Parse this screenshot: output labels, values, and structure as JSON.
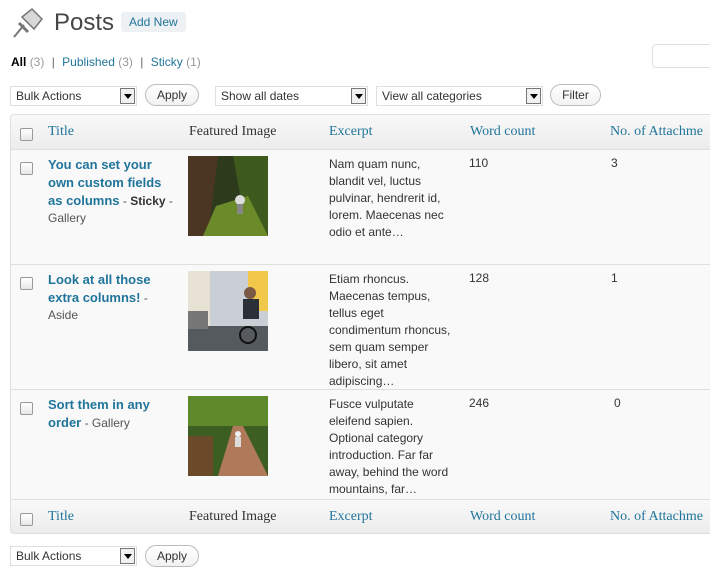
{
  "header": {
    "title": "Posts",
    "add_new_label": "Add New"
  },
  "views": {
    "all_label": "All",
    "all_count": "(3)",
    "published_label": "Published",
    "published_count": "(3)",
    "sticky_label": "Sticky",
    "sticky_count": "(1)",
    "separator": "|"
  },
  "filters": {
    "bulk_actions": "Bulk Actions",
    "apply_label": "Apply",
    "dates": "Show all dates",
    "categories": "View all categories",
    "filter_label": "Filter"
  },
  "columns": {
    "title": "Title",
    "featured_image": "Featured Image",
    "excerpt": "Excerpt",
    "word_count": "Word count",
    "attachments": "No. of Attachme"
  },
  "rows": [
    {
      "title": "You can set your own custom fields as columns",
      "sep1": " - ",
      "state": "Sticky",
      "sep2": " - ",
      "format": "Gallery",
      "excerpt": "Nam quam nunc, blandit vel, luctus pulvinar, hendrerit id, lorem. Maecenas nec odio et ante…",
      "word_count": "110",
      "attachments": "3"
    },
    {
      "title": "Look at all those extra columns!",
      "sep1": " - ",
      "format": "Aside",
      "excerpt": "Etiam rhoncus. Maecenas tempus, tellus eget condimentum rhoncus, sem quam semper libero, sit amet adipiscing…",
      "word_count": "128",
      "attachments": "1"
    },
    {
      "title": "Sort them in any order",
      "sep1": " - ",
      "format": "Gallery",
      "excerpt": "Fusce vulputate eleifend sapien. Optional category introduction. Far far away, behind the word mountains, far…",
      "word_count": "246",
      "attachments": "0"
    }
  ],
  "bottom": {
    "bulk_actions": "Bulk Actions",
    "apply_label": "Apply"
  },
  "colors": {
    "link": "#21759b",
    "header_bg": "#ececec",
    "border": "#dfdfdf"
  },
  "icons": {
    "page_icon": "pushpin-icon",
    "dropdown": "dropdown-arrow-icon"
  }
}
